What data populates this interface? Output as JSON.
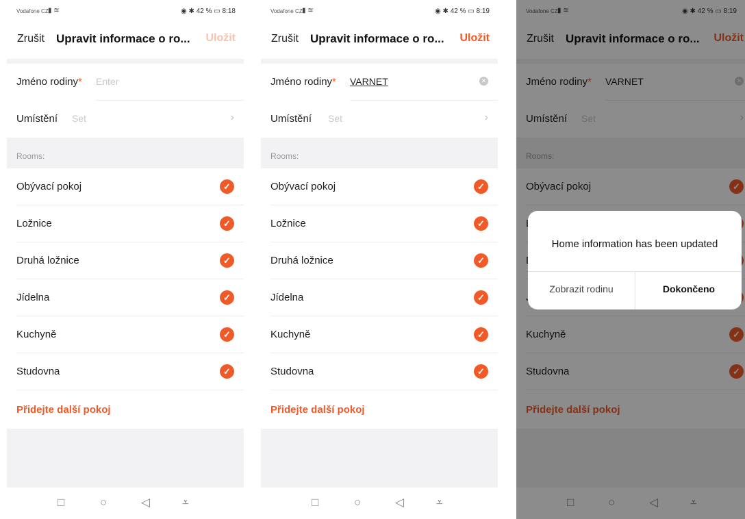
{
  "status": {
    "carrier": "Vodafone CZ",
    "battery": "42 %",
    "time1": "8:18",
    "time2": "8:19",
    "time3": "8:19"
  },
  "header": {
    "cancel": "Zrušit",
    "title": "Upravit informace o ro...",
    "save": "Uložit"
  },
  "form": {
    "family_name_label": "Jméno rodiny",
    "required_mark": "*",
    "family_name_placeholder": "Enter",
    "family_name_value": "VARNET",
    "location_label": "Umístění",
    "location_value": "Set"
  },
  "rooms_section": "Rooms:",
  "rooms": [
    "Obývací pokoj",
    "Ložnice",
    "Druhá ložnice",
    "Jídelna",
    "Kuchyně",
    "Studovna"
  ],
  "add_room": "Přidejte další pokoj",
  "dialog": {
    "message": "Home information has been updated",
    "left_button": "Zobrazit rodinu",
    "right_button": "Dokončeno"
  },
  "colors": {
    "accent": "#f05a28",
    "background": "#f2f2f4"
  },
  "icons": {
    "check": "check-circle-icon",
    "clear": "clear-icon",
    "chevron": "chevron-right-icon"
  }
}
